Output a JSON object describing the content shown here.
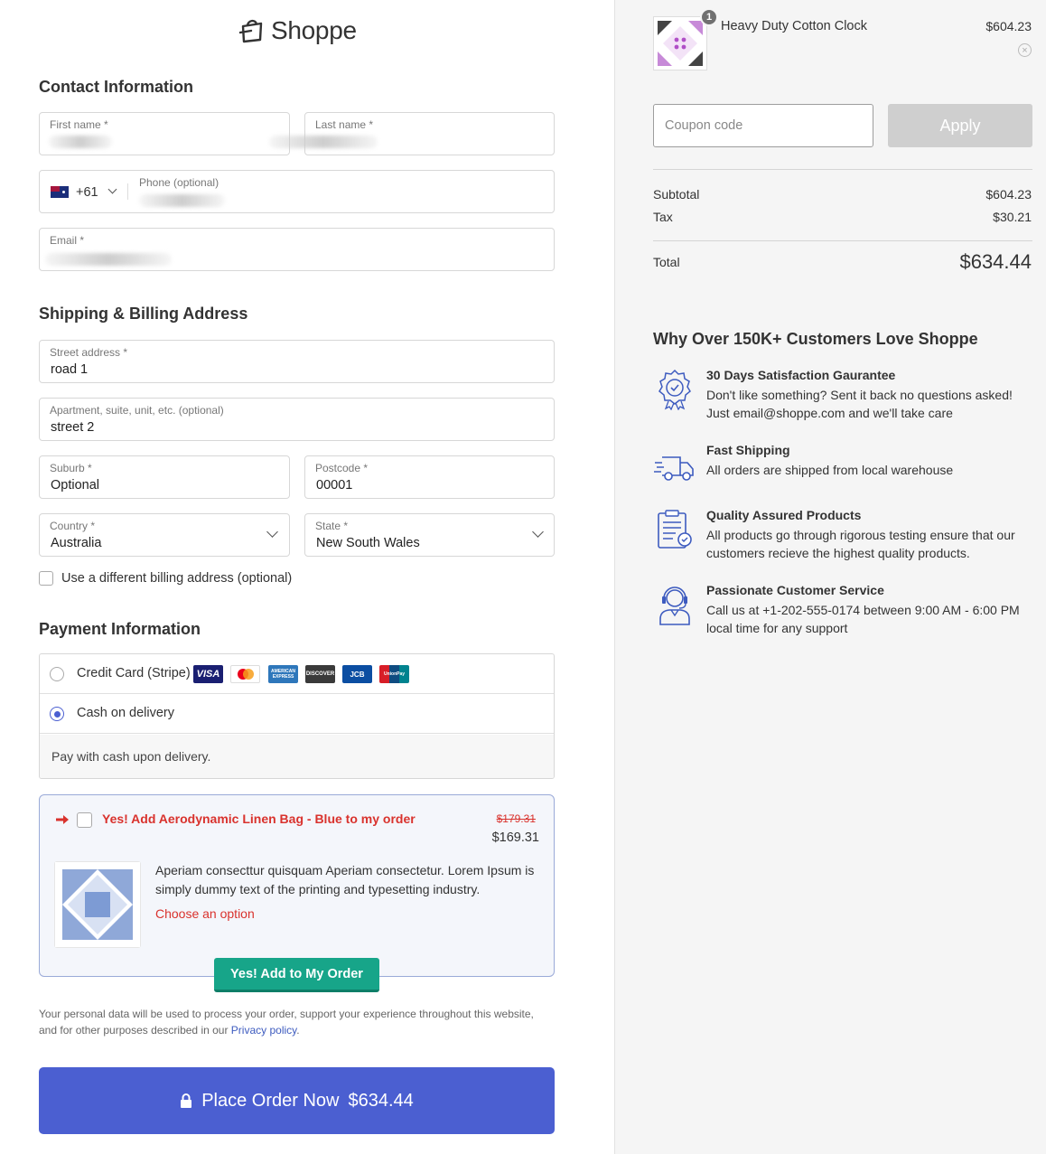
{
  "brand": {
    "name": "Shoppe"
  },
  "contact": {
    "title": "Contact Information",
    "first_name_label": "First name *",
    "last_name_label": "Last name *",
    "phone_code": "+61",
    "phone_label": "Phone (optional)",
    "email_label": "Email *"
  },
  "address": {
    "title": "Shipping & Billing Address",
    "street_label": "Street address *",
    "street_value": "road 1",
    "apt_label": "Apartment, suite, unit, etc. (optional)",
    "apt_value": "street 2",
    "suburb_label": "Suburb *",
    "suburb_value": "Optional",
    "postcode_label": "Postcode *",
    "postcode_value": "00001",
    "country_label": "Country *",
    "country_value": "Australia",
    "state_label": "State *",
    "state_value": "New South Wales",
    "billing_checkbox_label": "Use a different billing address (optional)"
  },
  "payment": {
    "title": "Payment Information",
    "card_option": "Credit Card (Stripe)",
    "cod_option": "Cash on delivery",
    "cod_note": "Pay with cash upon delivery.",
    "card_brands": [
      "VISA",
      "mastercard",
      "AMERICAN EXPRESS",
      "DISCOVER",
      "JCB",
      "UnionPay"
    ]
  },
  "bump": {
    "title": "Yes! Add Aerodynamic Linen Bag - Blue to my order",
    "old_price": "$179.31",
    "new_price": "$169.31",
    "description": "Aperiam consecttur quisquam Aperiam consectetur. Lorem Ipsum is simply dummy text of the printing and typesetting industry.",
    "option_link": "Choose an option",
    "button": "Yes! Add to My Order"
  },
  "privacy": {
    "text": "Your personal data will be used to process your order, support your experience throughout this website, and for other purposes described in our ",
    "link": "Privacy policy",
    "suffix": "."
  },
  "place_order": {
    "label": "Place Order Now",
    "amount": "$634.44"
  },
  "cart": {
    "qty": "1",
    "product_name": "Heavy Duty Cotton Clock",
    "product_price": "$604.23",
    "coupon_placeholder": "Coupon code",
    "apply": "Apply",
    "subtotal_label": "Subtotal",
    "subtotal": "$604.23",
    "tax_label": "Tax",
    "tax": "$30.21",
    "total_label": "Total",
    "total": "$634.44"
  },
  "why": {
    "title": "Why Over 150K+ Customers Love Shoppe",
    "features": [
      {
        "icon": "badge-check-icon",
        "title": "30 Days Satisfaction Gaurantee",
        "text": "Don't like something? Sent it back no questions asked! Just email@shoppe.com and we'll take care"
      },
      {
        "icon": "truck-icon",
        "title": "Fast Shipping",
        "text": "All orders are shipped from local warehouse"
      },
      {
        "icon": "clipboard-icon",
        "title": "Quality Assured Products",
        "text": "All products go through rigorous testing ensure that our customers recieve the highest quality products."
      },
      {
        "icon": "headset-agent-icon",
        "title": "Passionate Customer Service",
        "text": "Call us at +1-202-555-0174 between 9:00 AM - 6:00 PM local time for any support"
      }
    ]
  },
  "colors": {
    "primary": "#4b5fd1",
    "accent_green": "#17a589",
    "danger": "#d9322d"
  }
}
